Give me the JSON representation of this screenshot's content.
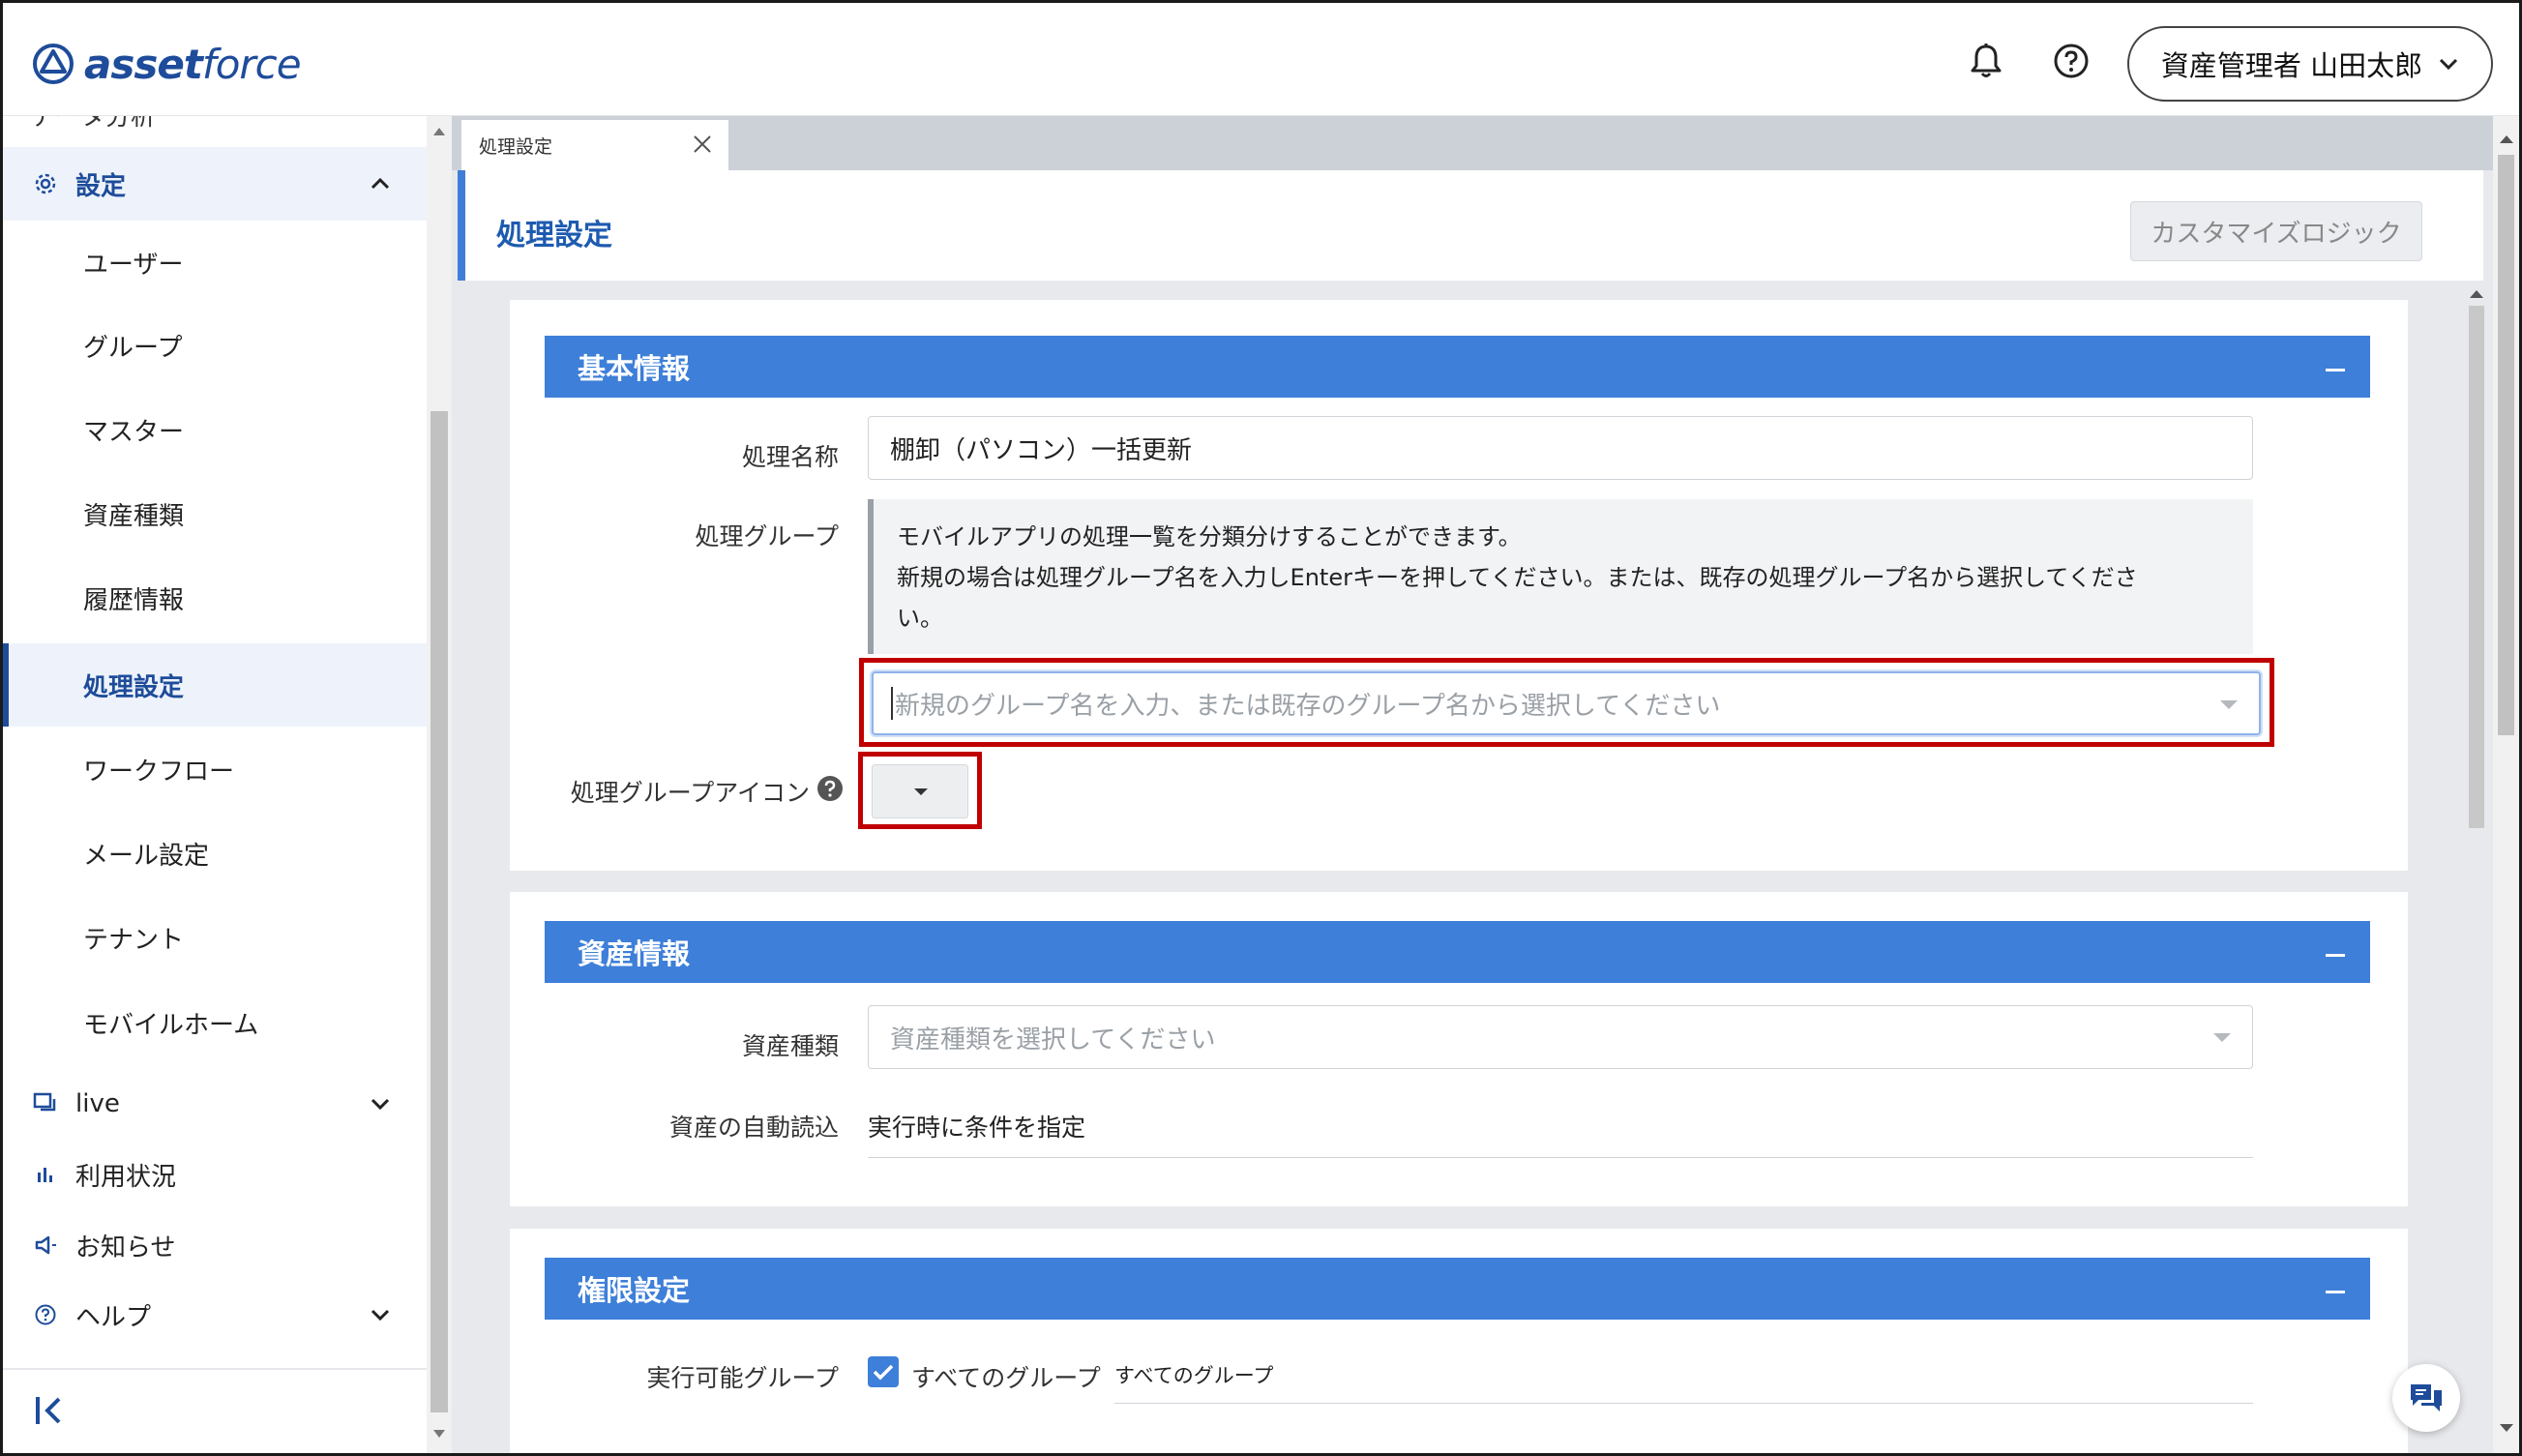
{
  "app": {
    "logo_word1": "asset",
    "logo_word2": "force",
    "user_label": "資産管理者 山田太郎"
  },
  "sidebar": {
    "cut_item_label": "データ分析",
    "settings_label": "設定",
    "items": [
      {
        "label": "ユーザー"
      },
      {
        "label": "グループ"
      },
      {
        "label": "マスター"
      },
      {
        "label": "資産種類"
      },
      {
        "label": "履歴情報"
      },
      {
        "label": "処理設定"
      },
      {
        "label": "ワークフロー"
      },
      {
        "label": "メール設定"
      },
      {
        "label": "テナント"
      },
      {
        "label": "モバイルホーム"
      }
    ],
    "live_label": "live",
    "usage_label": "利用状況",
    "news_label": "お知らせ",
    "help_label": "ヘルプ"
  },
  "tab": {
    "label": "処理設定"
  },
  "page": {
    "title": "処理設定",
    "customize_label": "カスタマイズロジック"
  },
  "basic": {
    "header": "基本情報",
    "name_label": "処理名称",
    "name_value": "棚卸（パソコン）一括更新",
    "group_label": "処理グループ",
    "group_hint_line1": "モバイルアプリの処理一覧を分類分けすることができます。",
    "group_hint_line2": "新規の場合は処理グループ名を入力しEnterキーを押してください。または、既存の処理グループ名から選択してくださ",
    "group_hint_line3": "い。",
    "group_placeholder": "新規のグループ名を入力、または既存のグループ名から選択してください",
    "icon_label": "処理グループアイコン"
  },
  "asset": {
    "header": "資産情報",
    "type_label": "資産種類",
    "type_placeholder": "資産種類を選択してください",
    "autoload_label": "資産の自動読込",
    "autoload_value": "実行時に条件を指定"
  },
  "permission": {
    "header": "権限設定",
    "exec_group_label": "実行可能グループ",
    "all_groups_label": "すべてのグループ",
    "all_groups_value": "すべてのグループ"
  },
  "colors": {
    "brand": "#1e4c9a",
    "section_header": "#3e7fd9",
    "highlight": "#c00000"
  }
}
